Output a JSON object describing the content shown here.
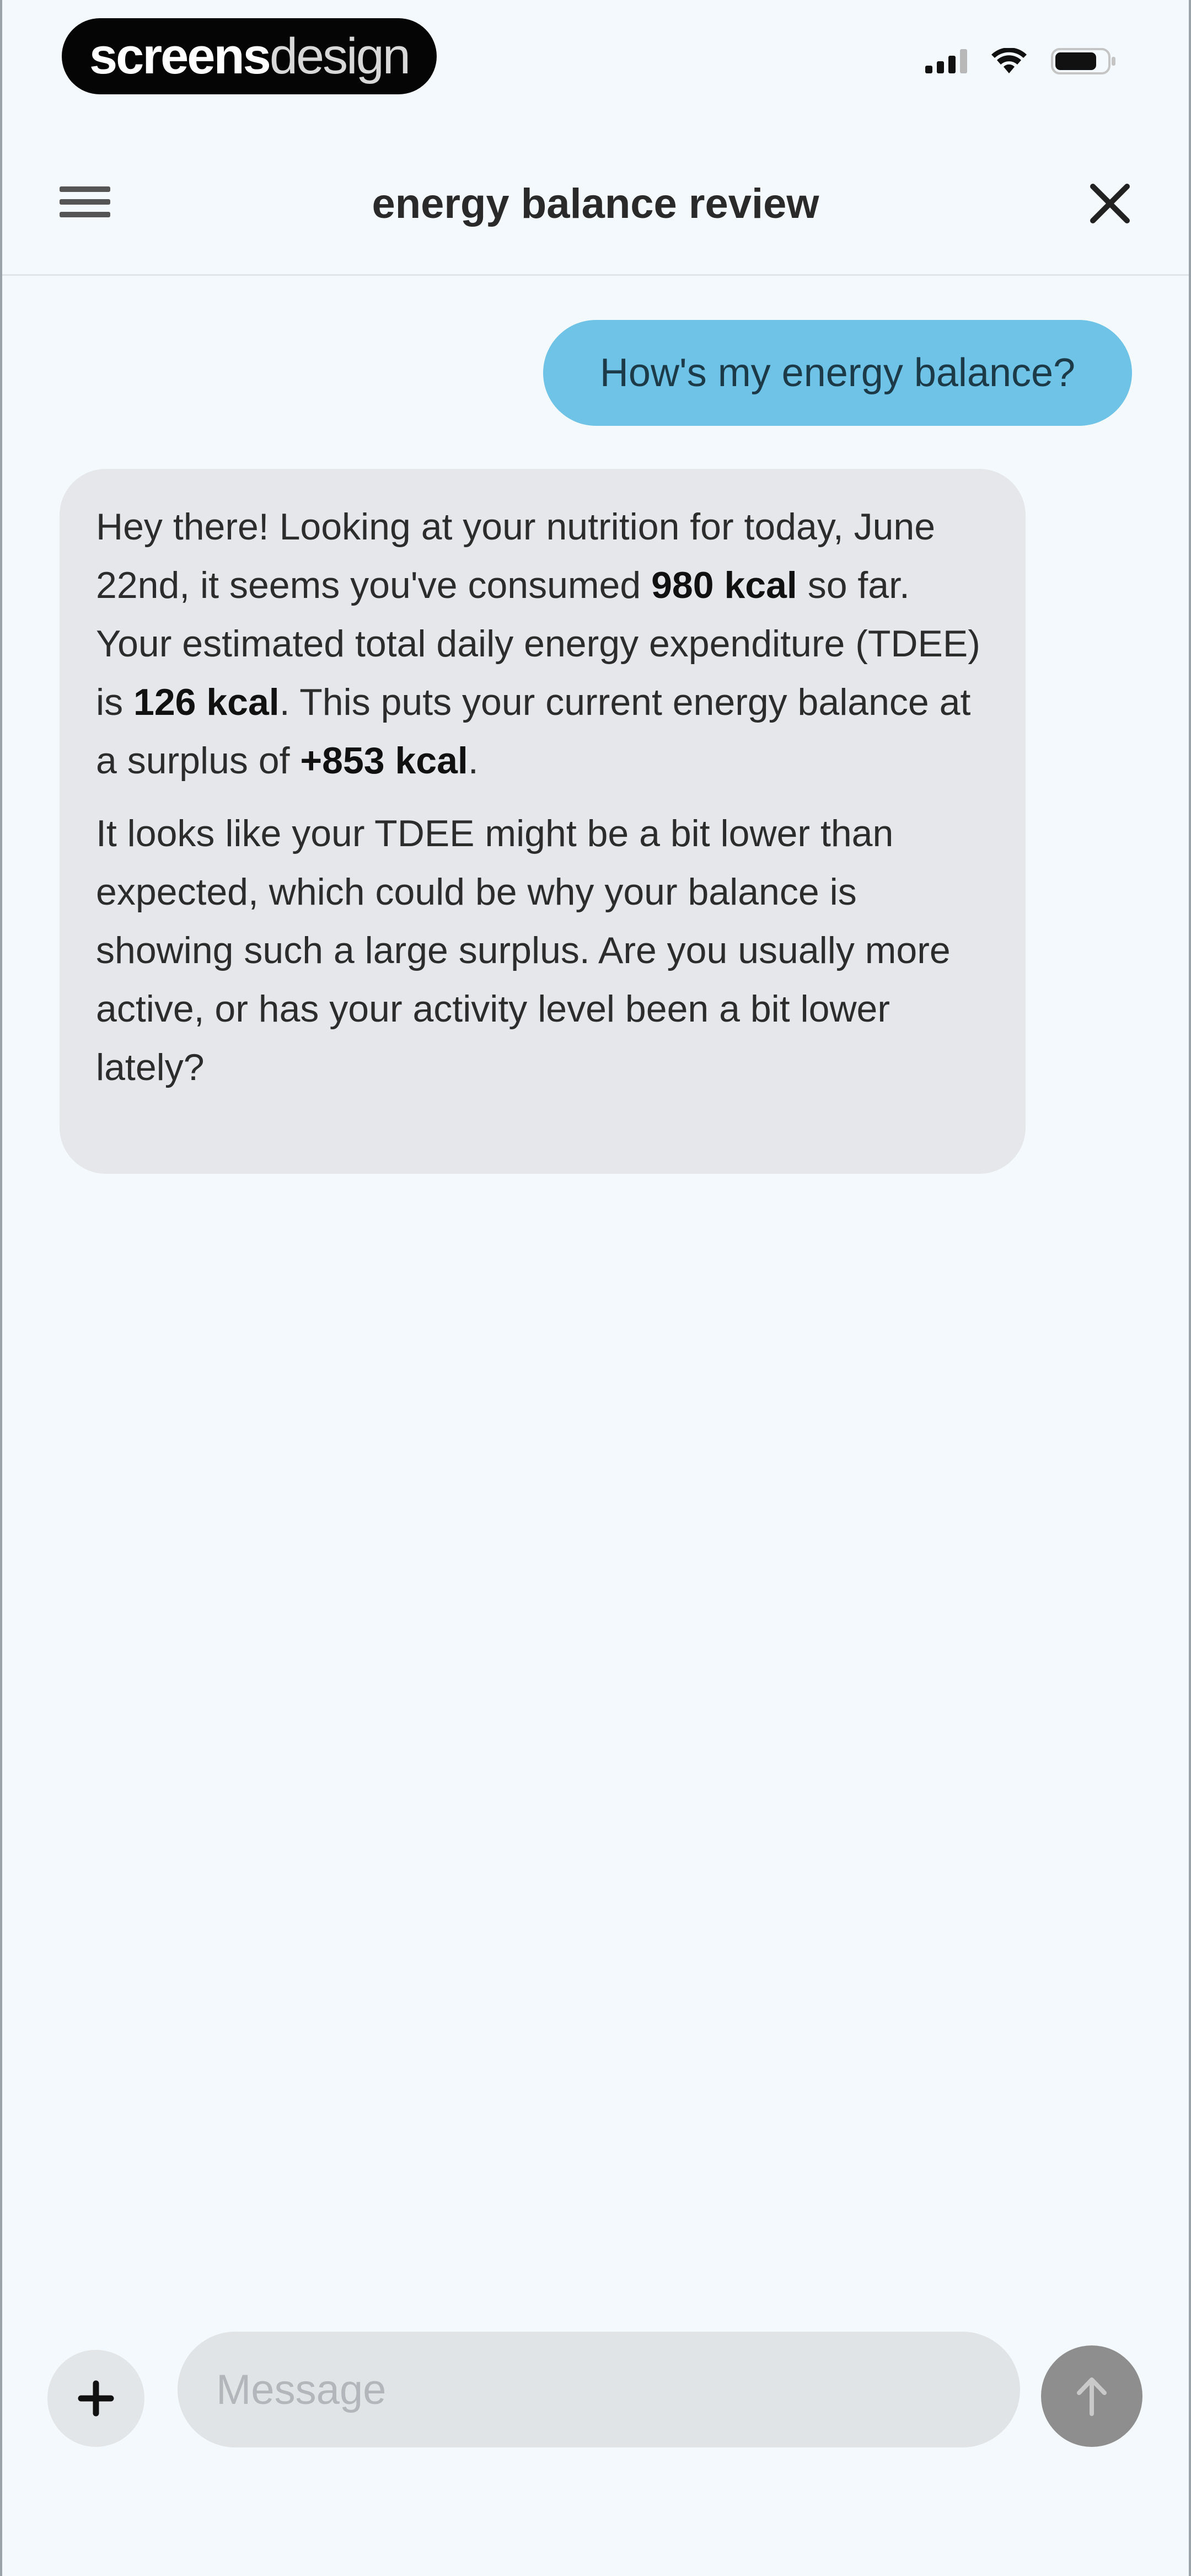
{
  "status_bar": {
    "brand_bold": "screens",
    "brand_light": "design",
    "icons": [
      "cellular-signal-icon",
      "wifi-icon",
      "battery-icon"
    ]
  },
  "header": {
    "title": "energy balance review",
    "menu_icon": "hamburger-menu-icon",
    "close_icon": "close-icon"
  },
  "conversation": {
    "user_message": "How's my energy balance?",
    "assistant": {
      "p1_a": "Hey there! Looking at your nutrition for today, June 22nd, it seems you've consumed ",
      "p1_b": "980 kcal",
      "p1_c": " so far. Your estimated total daily energy expenditure (TDEE) is ",
      "p1_d": "126 kcal",
      "p1_e": ". This puts your current energy balance at a surplus of ",
      "p1_f": "+853 kcal",
      "p1_g": ".",
      "p2": "It looks like your TDEE might be a bit lower than expected, which could be why your balance is showing such a large surplus. Are you usually more active, or has your activity level been a bit lower lately?"
    }
  },
  "composer": {
    "placeholder": "Message",
    "value": "",
    "add_icon": "plus-icon",
    "send_icon": "arrow-up-icon"
  },
  "colors": {
    "background": "#f3f9fc",
    "user_bubble": "#6ec3e6",
    "assistant_bubble": "#e5e7ea",
    "send_button": "#8e8e8e"
  }
}
